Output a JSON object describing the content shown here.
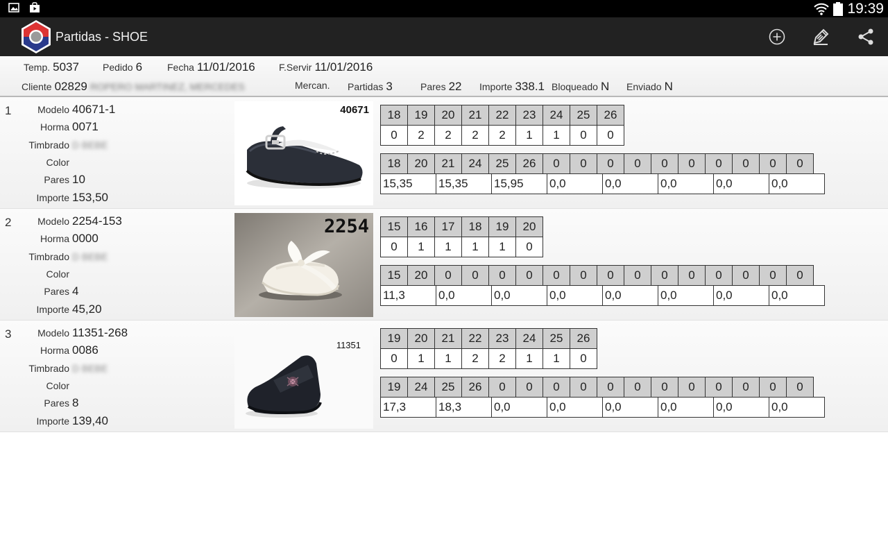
{
  "status_bar": {
    "time": "19:39"
  },
  "app": {
    "title": "Partidas - SHOE"
  },
  "header": {
    "temp": {
      "label": "Temp.",
      "value": "5037"
    },
    "pedido": {
      "label": "Pedido",
      "value": "6"
    },
    "fecha": {
      "label": "Fecha",
      "value": "11/01/2016"
    },
    "fservir": {
      "label": "F.Servir",
      "value": "11/01/2016"
    },
    "cliente": {
      "label": "Cliente",
      "value": "02829",
      "name": "ROPERO MARTINEZ, MERCEDES"
    },
    "mercan": {
      "label": "Mercan."
    },
    "partidas": {
      "label": "Partidas",
      "value": "3"
    },
    "pares": {
      "label": "Pares",
      "value": "22"
    },
    "importe": {
      "label": "Importe",
      "value": "338.1"
    },
    "bloqueado": {
      "label": "Bloqueado",
      "value": "N"
    },
    "enviado": {
      "label": "Enviado",
      "value": "N"
    }
  },
  "labels": {
    "modelo": "Modelo",
    "horma": "Horma",
    "timbrado": "Timbrado",
    "color": "Color",
    "pares": "Pares",
    "importe": "Importe"
  },
  "items": [
    {
      "index": "1",
      "modelo": "40671-1",
      "horma": "0071",
      "timbrado": "D BEBE",
      "color": "",
      "pares": "10",
      "importe": "153,50",
      "photo_code": "40671",
      "sizes": [
        "18",
        "19",
        "20",
        "21",
        "22",
        "23",
        "24",
        "25",
        "26"
      ],
      "quantities": [
        "0",
        "2",
        "2",
        "2",
        "2",
        "1",
        "1",
        "0",
        "0"
      ],
      "price_sizes": [
        "18",
        "20",
        "21",
        "24",
        "25",
        "26",
        "0",
        "0",
        "0",
        "0",
        "0",
        "0",
        "0",
        "0",
        "0",
        "0"
      ],
      "prices": [
        "15,35",
        "15,35",
        "15,95",
        "0,0",
        "0,0",
        "0,0",
        "0,0",
        "0,0"
      ]
    },
    {
      "index": "2",
      "modelo": "2254-153",
      "horma": "0000",
      "timbrado": "D BEBE",
      "color": "",
      "pares": "4",
      "importe": "45,20",
      "photo_code": "2254",
      "sizes": [
        "15",
        "16",
        "17",
        "18",
        "19",
        "20"
      ],
      "quantities": [
        "0",
        "1",
        "1",
        "1",
        "1",
        "0"
      ],
      "price_sizes": [
        "15",
        "20",
        "0",
        "0",
        "0",
        "0",
        "0",
        "0",
        "0",
        "0",
        "0",
        "0",
        "0",
        "0",
        "0",
        "0"
      ],
      "prices": [
        "11,3",
        "0,0",
        "0,0",
        "0,0",
        "0,0",
        "0,0",
        "0,0",
        "0,0"
      ]
    },
    {
      "index": "3",
      "modelo": "11351-268",
      "horma": "0086",
      "timbrado": "D BEBE",
      "color": "",
      "pares": "8",
      "importe": "139,40",
      "photo_code": "11351",
      "sizes": [
        "19",
        "20",
        "21",
        "22",
        "23",
        "24",
        "25",
        "26"
      ],
      "quantities": [
        "0",
        "1",
        "1",
        "2",
        "2",
        "1",
        "1",
        "0"
      ],
      "price_sizes": [
        "19",
        "24",
        "25",
        "26",
        "0",
        "0",
        "0",
        "0",
        "0",
        "0",
        "0",
        "0",
        "0",
        "0",
        "0",
        "0"
      ],
      "prices": [
        "17,3",
        "18,3",
        "0,0",
        "0,0",
        "0,0",
        "0,0",
        "0,0",
        "0,0"
      ]
    }
  ]
}
